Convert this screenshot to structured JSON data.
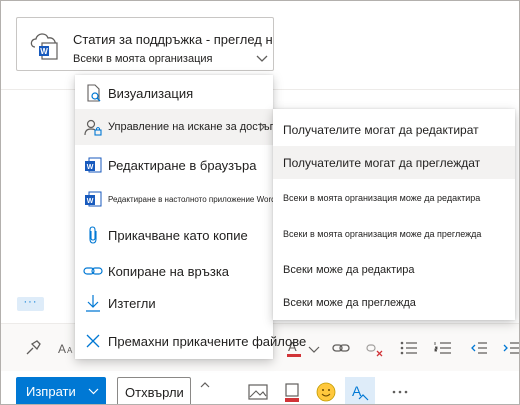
{
  "attachment": {
    "title": "Статия за поддръжка - преглед на...",
    "subtitle": "Всеки в моята организация",
    "icon": "cloud-word-icon"
  },
  "menu": {
    "items": [
      {
        "label": "Визуализация",
        "icon": "preview-icon"
      },
      {
        "label": "Управление на искане за достъп",
        "icon": "manage-access-icon",
        "active": true
      },
      {
        "label": "Редактиране в браузъра",
        "icon": "word-icon"
      },
      {
        "label": "Редактиране в настолното приложение Word",
        "icon": "word-icon"
      },
      {
        "label": "Прикачване като копие",
        "icon": "paperclip-icon"
      },
      {
        "label": "Копиране на връзка",
        "icon": "link-icon"
      },
      {
        "label": "Изтегли",
        "icon": "download-icon"
      },
      {
        "label": "Премахни прикачените файлове",
        "icon": "close-icon"
      }
    ]
  },
  "submenu": {
    "items": [
      {
        "label": "Получателите могат да редактират"
      },
      {
        "label": "Получателите могат да преглеждат",
        "hover": true
      },
      {
        "label": "Всеки в моята организация може да редактира"
      },
      {
        "label": "Всеки в моята организация може да преглежда"
      },
      {
        "label": "Всеки може да редактира"
      },
      {
        "label": "Всеки може да преглежда"
      }
    ]
  },
  "compose": {
    "more_label": "···",
    "send_label": "Изпрати",
    "discard_label": "Отхвърли"
  },
  "colors": {
    "accent": "#0078d4",
    "word_blue": "#185abd",
    "menu_hover": "#f3f2f1"
  }
}
